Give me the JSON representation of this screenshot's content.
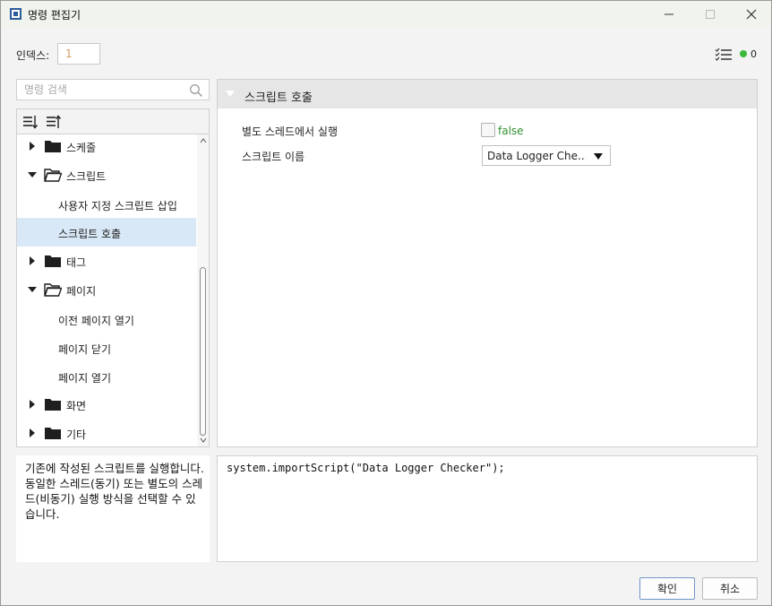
{
  "window": {
    "title": "명령 편집기"
  },
  "index": {
    "label": "인덱스:",
    "value": "1"
  },
  "status": {
    "count": "0",
    "dot_color": "#3cb83a"
  },
  "search": {
    "placeholder": "명령 검색"
  },
  "tree": {
    "items": [
      {
        "label": "스케줄",
        "type": "folder",
        "expanded": false
      },
      {
        "label": "스크립트",
        "type": "folder",
        "expanded": true
      },
      {
        "label": "사용자 지정 스크립트 삽입",
        "type": "leaf"
      },
      {
        "label": "스크립트 호출",
        "type": "leaf",
        "selected": true
      },
      {
        "label": "태그",
        "type": "folder",
        "expanded": false
      },
      {
        "label": "페이지",
        "type": "folder",
        "expanded": true
      },
      {
        "label": "이전 페이지 열기",
        "type": "leaf"
      },
      {
        "label": "페이지 닫기",
        "type": "leaf"
      },
      {
        "label": "페이지 열기",
        "type": "leaf"
      },
      {
        "label": "화면",
        "type": "folder",
        "expanded": false
      },
      {
        "label": "기타",
        "type": "folder",
        "expanded": false
      }
    ]
  },
  "props": {
    "title": "스크립트 호출",
    "separate_thread_label": "별도 스레드에서 실행",
    "separate_thread_value": "false",
    "script_name_label": "스크립트 이름",
    "script_name_value": "Data Logger Che..."
  },
  "description": "기존에 작성된 스크립트를 실행합니다. 동일한 스레드(동기) 또는 별도의 스레드(비동기) 실행 방식을 선택할 수 있습니다.",
  "code": "system.importScript(\"Data Logger Checker\");",
  "buttons": {
    "ok": "확인",
    "cancel": "취소"
  }
}
